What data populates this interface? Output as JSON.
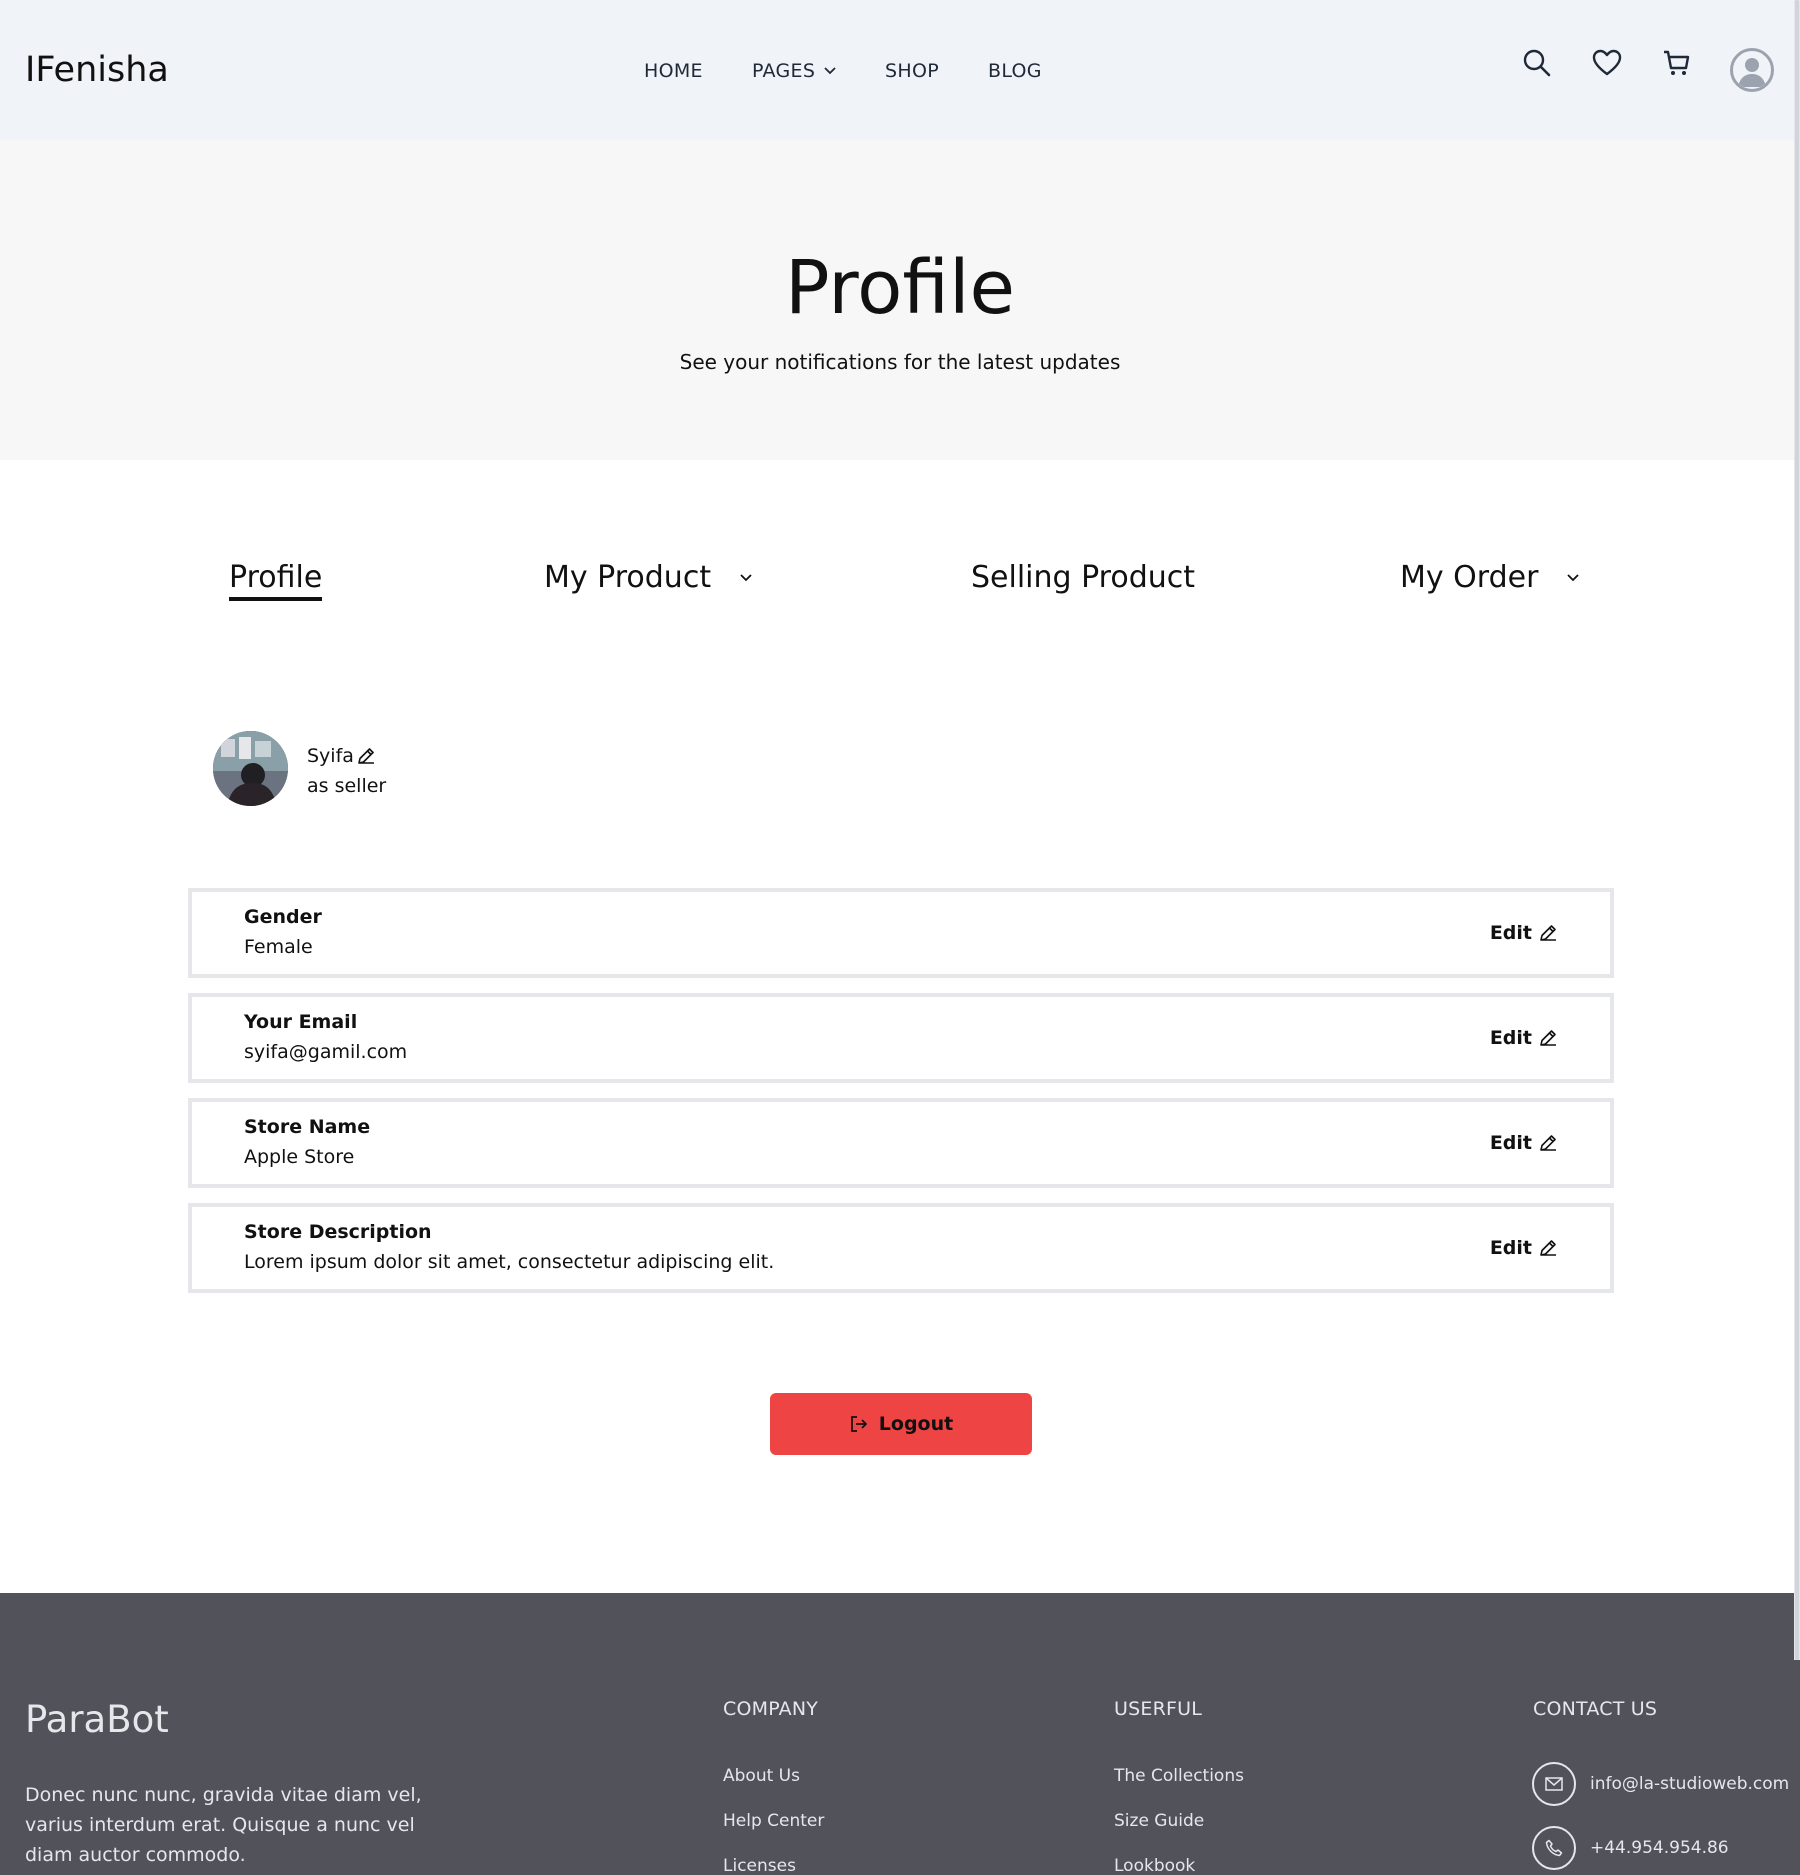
{
  "header": {
    "logo": "IFenisha",
    "nav": {
      "home": "HOME",
      "pages": "PAGES",
      "shop": "SHOP",
      "blog": "BLOG"
    },
    "icons": [
      "search-icon",
      "heart-icon",
      "cart-icon",
      "user-avatar-icon"
    ]
  },
  "hero": {
    "title": "Profile",
    "subtitle": "See your notifications for the latest updates"
  },
  "tabs": {
    "profile": "Profile",
    "my_product": "My Product",
    "selling_product": "Selling Product",
    "my_order": "My Order"
  },
  "profile": {
    "name": "Syifa",
    "role": "as seller"
  },
  "fields": [
    {
      "label": "Gender",
      "value": "Female",
      "action": "Edit"
    },
    {
      "label": "Your Email",
      "value": "syifa@gamil.com",
      "action": "Edit"
    },
    {
      "label": "Store Name",
      "value": "Apple Store",
      "action": "Edit"
    },
    {
      "label": "Store Description",
      "value": "Lorem ipsum dolor sit amet, consectetur adipiscing elit.",
      "action": "Edit"
    }
  ],
  "logout_label": "Logout",
  "footer": {
    "brand": "ParaBot",
    "description": "Donec nunc nunc, gravida vitae diam vel, varius interdum erat. Quisque a nunc vel diam auctor commodo.",
    "company": {
      "heading": "COMPANY",
      "links": [
        "About Us",
        "Help Center",
        "Licenses"
      ]
    },
    "useful": {
      "heading": "USERFUL",
      "links": [
        "The Collections",
        "Size Guide",
        "Lookbook"
      ]
    },
    "contact": {
      "heading": "CONTACT US",
      "email": "info@la-studioweb.com",
      "phone": "+44.954.954.86"
    }
  },
  "colors": {
    "header_bg": "#f0f3f8",
    "hero_bg": "#f7f7f8",
    "logout_bg": "#ef4444",
    "footer_bg": "#52525b"
  }
}
